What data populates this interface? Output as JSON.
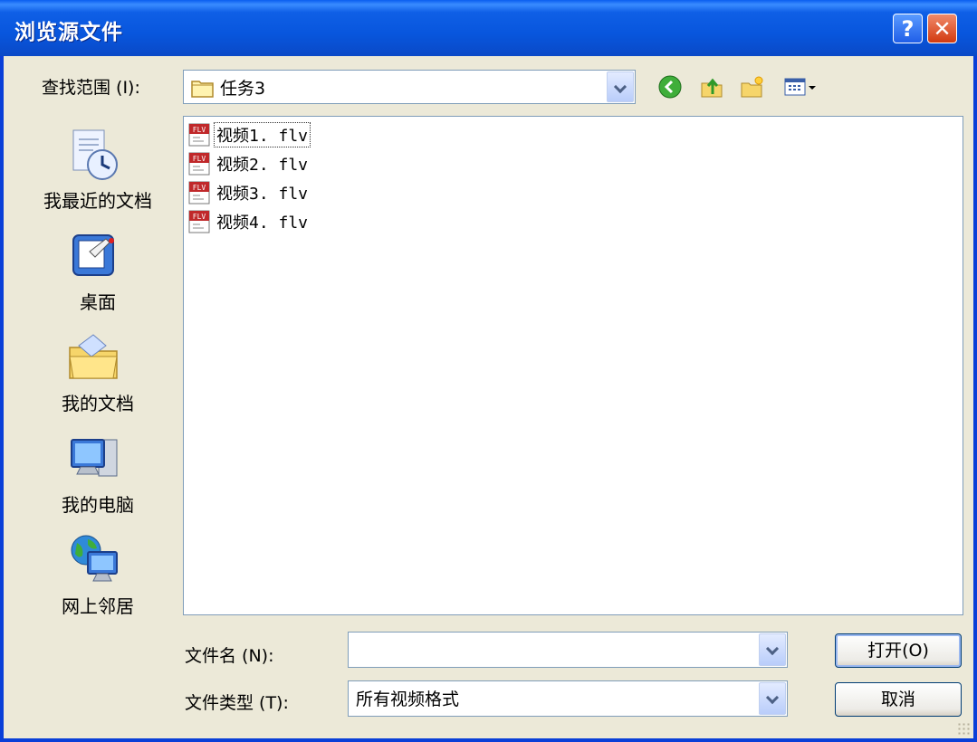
{
  "window": {
    "title": "浏览源文件"
  },
  "titlebar": {
    "help_label": "?",
    "close_label": "✕"
  },
  "lookin": {
    "label": "查找范围 (I):",
    "value": "任务3"
  },
  "places": [
    {
      "label": "我最近的文档",
      "icon": "recent-documents-icon"
    },
    {
      "label": "桌面",
      "icon": "desktop-icon"
    },
    {
      "label": "我的文档",
      "icon": "my-documents-icon"
    },
    {
      "label": "我的电脑",
      "icon": "my-computer-icon"
    },
    {
      "label": "网上邻居",
      "icon": "network-places-icon"
    }
  ],
  "files": [
    {
      "name": "视频1. flv",
      "badge": "FLV"
    },
    {
      "name": "视频2. flv",
      "badge": "FLV"
    },
    {
      "name": "视频3. flv",
      "badge": "FLV"
    },
    {
      "name": "视频4. flv",
      "badge": "FLV"
    }
  ],
  "filename": {
    "label": "文件名 (N):",
    "value": ""
  },
  "filetype": {
    "label": "文件类型 (T):",
    "value": "所有视频格式"
  },
  "buttons": {
    "open": "打开(O)",
    "cancel": "取消"
  }
}
